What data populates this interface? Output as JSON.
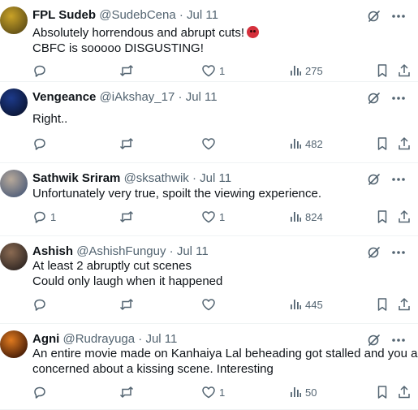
{
  "tweets": [
    {
      "name": "FPL Sudeb",
      "handle": "@SudebCena",
      "separator": "·",
      "date": "Jul 11",
      "lines": [
        "Absolutely horrendous and abrupt cuts!",
        "CBFC is sooooo DISGUSTING!"
      ],
      "has_emoji": true,
      "replies": "",
      "reposts": "",
      "likes": "1",
      "views": "275",
      "avatar_colors": [
        "#c9a227",
        "#5a4a16"
      ]
    },
    {
      "name": "Vengeance",
      "handle": "@iAkshay_17",
      "separator": "·",
      "date": "Jul 11",
      "lines": [
        "Right.."
      ],
      "has_emoji": false,
      "replies": "",
      "reposts": "",
      "likes": "",
      "views": "482",
      "avatar_colors": [
        "#1d3a8a",
        "#0a1430"
      ]
    },
    {
      "name": "Sathwik Sriram",
      "handle": "@sksathwik",
      "separator": "·",
      "date": "Jul 11",
      "lines": [
        "Unfortunately very true, spoilt the viewing experience."
      ],
      "has_emoji": false,
      "replies": "1",
      "reposts": "",
      "likes": "1",
      "views": "824",
      "avatar_colors": [
        "#b7a99a",
        "#4a5a78"
      ]
    },
    {
      "name": "Ashish",
      "handle": "@AshishFunguy",
      "separator": "·",
      "date": "Jul 11",
      "lines": [
        "At least 2 abruptly cut scenes",
        "Could only laugh when it happened"
      ],
      "has_emoji": false,
      "replies": "",
      "reposts": "",
      "likes": "",
      "views": "445",
      "avatar_colors": [
        "#8a6a52",
        "#2b2320"
      ]
    },
    {
      "name": "Agni",
      "handle": "@Rudrayuga",
      "separator": "·",
      "date": "Jul 11",
      "lines": [
        "An entire movie made on Kanhaiya Lal beheading got stalled and you are",
        "concerned about a kissing scene. Interesting"
      ],
      "has_emoji": false,
      "replies": "",
      "reposts": "",
      "likes": "1",
      "views": "50",
      "avatar_colors": [
        "#e07a1f",
        "#3a1505"
      ]
    }
  ],
  "colors": {
    "text": "#0f1419",
    "secondary": "#536471",
    "divider": "#eff3f4"
  },
  "icons": [
    "grok-icon",
    "more-icon",
    "reply-icon",
    "repost-icon",
    "like-icon",
    "views-icon",
    "bookmark-icon",
    "share-icon"
  ]
}
